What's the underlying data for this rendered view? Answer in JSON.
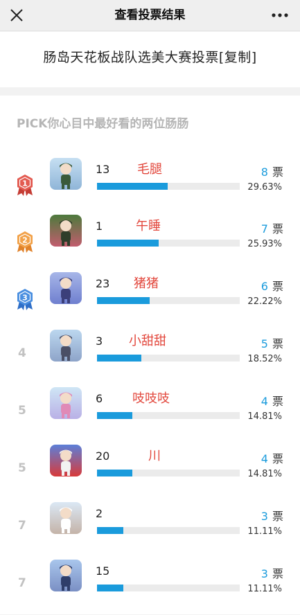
{
  "nav": {
    "title": "查看投票结果",
    "close_icon": "close-icon",
    "more_icon": "more-dots-icon"
  },
  "survey": {
    "title": "肠岛天花板战队选美大赛投票[复制]"
  },
  "question": {
    "text": "PICK你心目中最好看的两位肠肠"
  },
  "colors": {
    "accent": "#1a9bdc",
    "name_red": "#e2463b",
    "rank1": "#e35a50",
    "rank2": "#f2a24a",
    "rank3": "#4a8fe0"
  },
  "votes_unit": "票",
  "results": [
    {
      "rank": "1",
      "number": "13",
      "name": "毛腿",
      "votes": "8",
      "percent_label": "29.63%",
      "percent": 29.63,
      "avatar_icon": "character-avatar-icon"
    },
    {
      "rank": "2",
      "number": "1",
      "name": "午睡",
      "votes": "7",
      "percent_label": "25.93%",
      "percent": 25.93,
      "avatar_icon": "character-avatar-icon"
    },
    {
      "rank": "3",
      "number": "23",
      "name": "猪猪",
      "votes": "6",
      "percent_label": "22.22%",
      "percent": 22.22,
      "avatar_icon": "character-avatar-icon"
    },
    {
      "rank": "4",
      "number": "3",
      "name": "小甜甜",
      "votes": "5",
      "percent_label": "18.52%",
      "percent": 18.52,
      "avatar_icon": "character-avatar-icon"
    },
    {
      "rank": "5",
      "number": "6",
      "name": "吱吱吱",
      "votes": "4",
      "percent_label": "14.81%",
      "percent": 14.81,
      "avatar_icon": "character-avatar-icon"
    },
    {
      "rank": "5",
      "number": "20",
      "name": "川",
      "votes": "4",
      "percent_label": "14.81%",
      "percent": 14.81,
      "avatar_icon": "character-avatar-icon"
    },
    {
      "rank": "7",
      "number": "2",
      "name": "",
      "votes": "3",
      "percent_label": "11.11%",
      "percent": 11.11,
      "avatar_icon": "character-avatar-icon"
    },
    {
      "rank": "7",
      "number": "15",
      "name": "",
      "votes": "3",
      "percent_label": "11.11%",
      "percent": 11.11,
      "avatar_icon": "character-avatar-icon"
    }
  ]
}
